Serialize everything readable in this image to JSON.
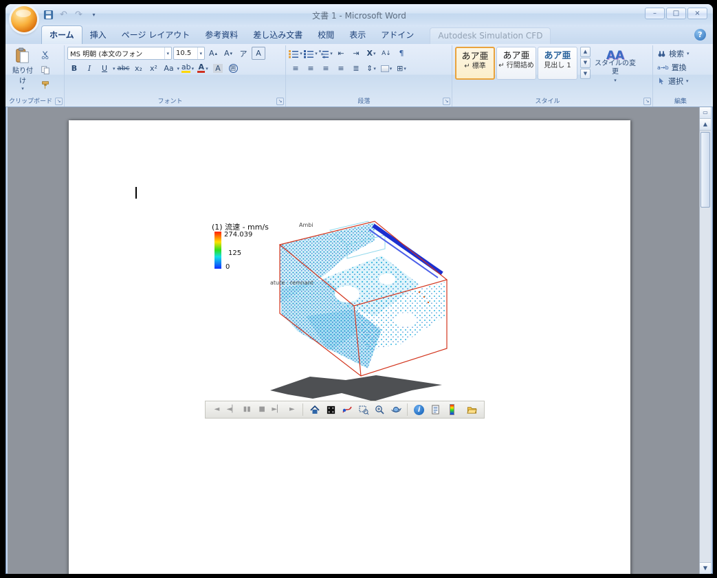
{
  "window": {
    "title": "文書 1 - Microsoft Word"
  },
  "icons": {
    "undo": "↶",
    "redo": "↷",
    "caret": "▾",
    "help": "?",
    "minimize": "–",
    "maximize": "□",
    "close": "×",
    "launcher": "↘",
    "up": "▲",
    "down": "▼",
    "more": "▼",
    "grow": "A",
    "shrink": "A",
    "ruby": "ア",
    "charbox": "A",
    "indent_dec": "⇤",
    "indent_inc": "⇥",
    "ext_format": "X",
    "sort": "A↓",
    "pilcrow": "¶",
    "align": "≡",
    "distribute": "≣",
    "spacing": "⇕",
    "borders": "⊞",
    "replace": "a→b",
    "scroll_icon": "▭"
  },
  "tabs": [
    {
      "label": "ホーム",
      "state": "active"
    },
    {
      "label": "挿入"
    },
    {
      "label": "ページ レイアウト"
    },
    {
      "label": "参考資料"
    },
    {
      "label": "差し込み文書"
    },
    {
      "label": "校閲"
    },
    {
      "label": "表示"
    },
    {
      "label": "アドイン"
    },
    {
      "label": "Autodesk Simulation CFD",
      "state": "disabled"
    }
  ],
  "ribbon": {
    "clipboard": {
      "label": "クリップボード",
      "paste": "貼り付け"
    },
    "font": {
      "label": "フォント",
      "name": "MS 明朝 (本文のフォン",
      "size": "10.5",
      "bold": "B",
      "italic": "I",
      "underline": "U",
      "strike": "abc",
      "subscript": "x₂",
      "superscript": "x²",
      "case": "Aa",
      "highlight": "ab",
      "color": "A",
      "shading": "A",
      "enclose": "囲"
    },
    "paragraph": {
      "label": "段落"
    },
    "styles": {
      "label": "スタイル",
      "preview": "あア亜",
      "items": [
        {
          "name": "↵ 標準",
          "selected": true
        },
        {
          "name": "↵ 行間詰め"
        },
        {
          "name": "見出し 1"
        }
      ],
      "change": "スタイルの変更",
      "change_icon": "AA"
    },
    "editing": {
      "label": "編集",
      "find": "検索",
      "replace": "置換",
      "select": "選択"
    }
  },
  "document": {
    "cfd": {
      "legend": {
        "title": "(1) 流速 - mm/s",
        "max": "274.039",
        "mid": "125",
        "min": "0"
      },
      "annotations": {
        "top": "Ambi",
        "side": "ature : remnant"
      },
      "playback": [
        "◄",
        "◄▏",
        "▮▮",
        "■",
        "►▏",
        "►"
      ],
      "tools": [
        "home",
        "fit-view",
        "trace",
        "zoom-window",
        "zoom-in",
        "orbit",
        "info",
        "report",
        "legend",
        "open"
      ],
      "info_glyph": "i"
    }
  },
  "colors": {
    "legend_top": "#ff2000",
    "legend_bottom": "#1030ff",
    "wireframe_red": "#d2331b",
    "vector_blue": "#2496cf",
    "beam_blue": "#1b2fd0",
    "shadow_grey": "#4e5053",
    "style_selected_border": "#e9a33c",
    "doc_background": "#8f949c"
  }
}
